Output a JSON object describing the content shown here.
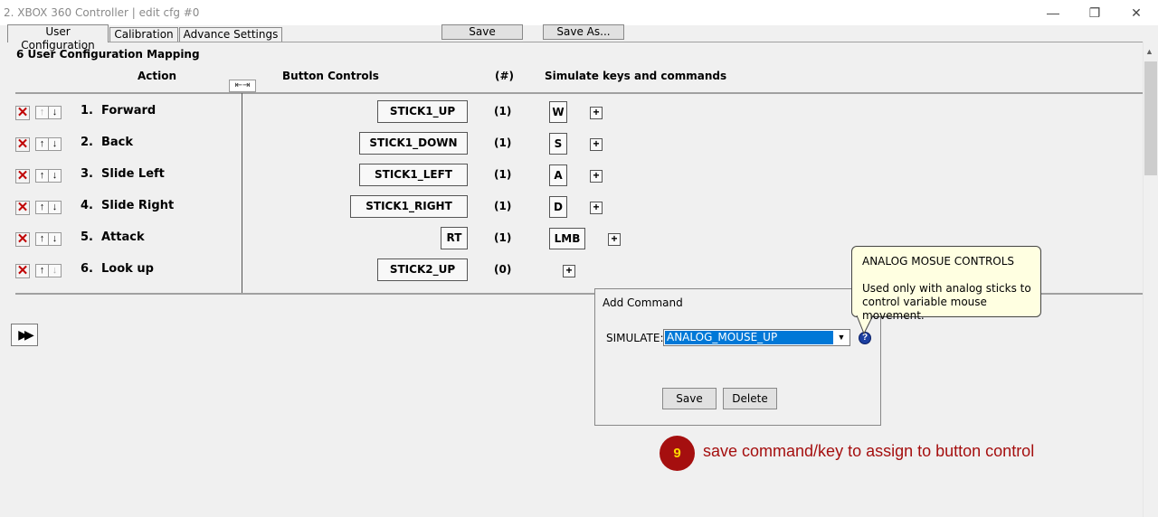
{
  "window": {
    "title": "2. XBOX 360 Controller  |  edit cfg #0",
    "minimize": "—",
    "restore": "❐",
    "close": "✕"
  },
  "tabs": [
    {
      "label": "User Configuration",
      "active": true
    },
    {
      "label": "Calibration",
      "active": false
    },
    {
      "label": "Advance Settings",
      "active": false
    }
  ],
  "toolbar": {
    "save": "Save",
    "save_as": "Save As..."
  },
  "mapping": {
    "title": "6 User Configuration Mapping",
    "headers": {
      "action": "Action",
      "button_controls": "Button Controls",
      "count": "(#)",
      "simulate": "Simulate keys and commands"
    },
    "rows": [
      {
        "num": "1.",
        "name": "Forward",
        "control": "STICK1_UP",
        "count": "(1)",
        "key": "W"
      },
      {
        "num": "2.",
        "name": "Back",
        "control": "STICK1_DOWN",
        "count": "(1)",
        "key": "S"
      },
      {
        "num": "3.",
        "name": "Slide Left",
        "control": "STICK1_LEFT",
        "count": "(1)",
        "key": "A"
      },
      {
        "num": "4.",
        "name": "Slide Right",
        "control": "STICK1_RIGHT",
        "count": "(1)",
        "key": "D"
      },
      {
        "num": "5.",
        "name": "Attack",
        "control": "RT",
        "count": "(1)",
        "key": "LMB"
      },
      {
        "num": "6.",
        "name": "Look up",
        "control": "STICK2_UP",
        "count": "(0)",
        "key": ""
      }
    ]
  },
  "dialog": {
    "title": "Add Command",
    "simulate_label": "SIMULATE:",
    "simulate_value": "ANALOG_MOUSE_UP",
    "save": "Save",
    "delete": "Delete"
  },
  "tooltip": {
    "title": "ANALOG MOSUE CONTROLS",
    "body": "Used only with analog sticks to control variable mouse movement."
  },
  "step": {
    "number": "9",
    "text": "save command/key to assign to button control"
  },
  "colors": {
    "accent": "#a50f0f",
    "step_number": "#ffd700",
    "selection": "#0078d7",
    "tooltip_bg": "#ffffe1"
  }
}
